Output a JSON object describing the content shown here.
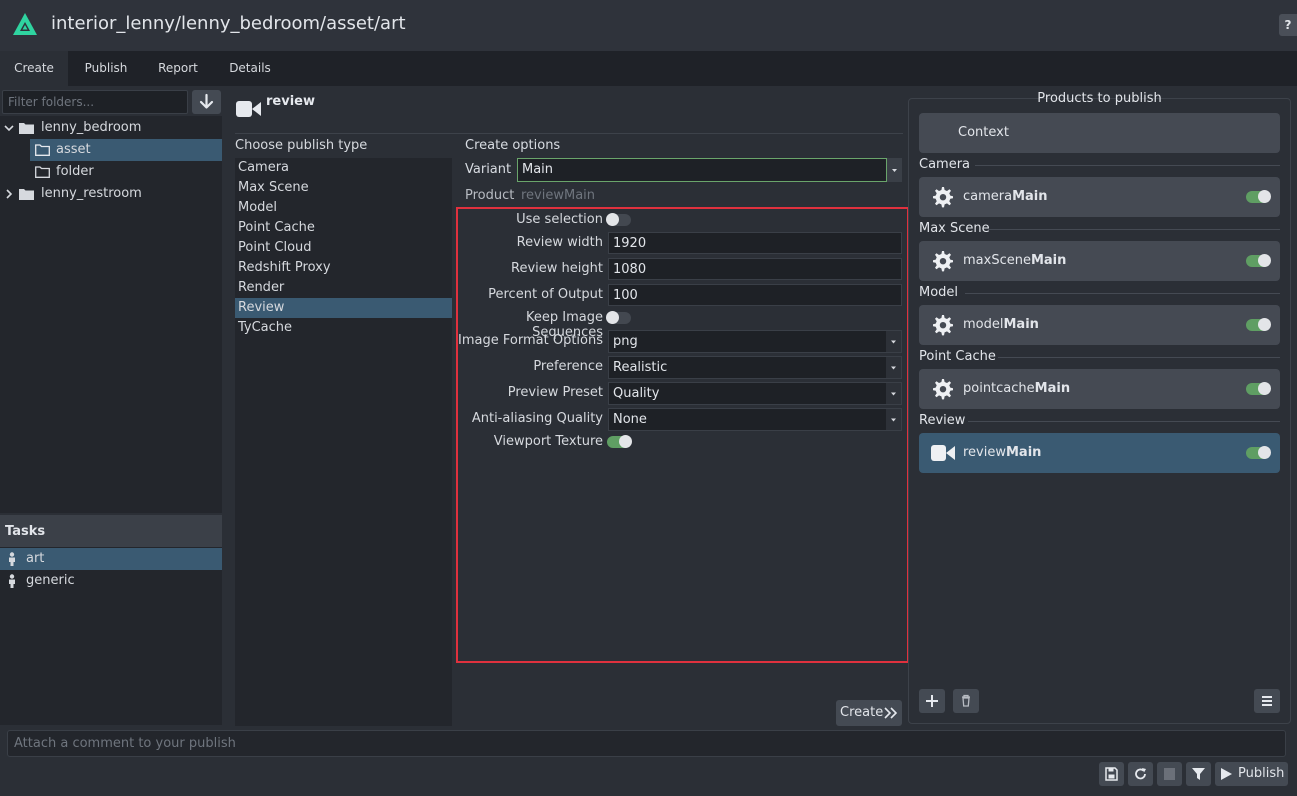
{
  "window": {
    "title": "interior_lenny/lenny_bedroom/asset/art",
    "help_label": "?"
  },
  "tabs": [
    "Create",
    "Publish",
    "Report",
    "Details"
  ],
  "folders": {
    "filter_placeholder": "Filter folders...",
    "items": [
      "lenny_bedroom",
      "asset",
      "folder",
      "lenny_restroom"
    ]
  },
  "tasks": {
    "header": "Tasks",
    "items": [
      "art",
      "generic"
    ]
  },
  "creator": {
    "name": "review",
    "choose_title": "Choose publish type",
    "types": [
      "Camera",
      "Max Scene",
      "Model",
      "Point Cache",
      "Point Cloud",
      "Redshift Proxy",
      "Render",
      "Review",
      "TyCache"
    ],
    "selected_type": "Review"
  },
  "options": {
    "title": "Create options",
    "variant_label": "Variant",
    "variant_value": "Main",
    "product_label": "Product",
    "product_value": "reviewMain",
    "use_selection_label": "Use selection",
    "use_selection": false,
    "review_width_label": "Review width",
    "review_width": "1920",
    "review_height_label": "Review height",
    "review_height": "1080",
    "percent_label": "Percent of Output",
    "percent": "100",
    "keep_seq_label": "Keep Image Sequences",
    "keep_seq": false,
    "image_format_label": "Image Format Options",
    "image_format": "png",
    "preference_label": "Preference",
    "preference": "Realistic",
    "preview_preset_label": "Preview Preset",
    "preview_preset": "Quality",
    "anti_alias_label": "Anti-aliasing Quality",
    "anti_alias": "None",
    "viewport_texture_label": "Viewport Texture",
    "viewport_texture": true,
    "create_label": "Create"
  },
  "products": {
    "title": "Products to publish",
    "context_label": "Context",
    "groups": [
      {
        "label": "Camera",
        "prefix": "camera",
        "suffix": "Main",
        "icon": "gear-icon"
      },
      {
        "label": "Max Scene",
        "prefix": "maxScene",
        "suffix": "Main",
        "icon": "gear-icon"
      },
      {
        "label": "Model",
        "prefix": "model",
        "suffix": "Main",
        "icon": "gear-icon"
      },
      {
        "label": "Point Cache",
        "prefix": "pointcache",
        "suffix": "Main",
        "icon": "gear-icon"
      },
      {
        "label": "Review",
        "prefix": "review",
        "suffix": "Main",
        "icon": "video-camera-icon"
      }
    ]
  },
  "bottom": {
    "comment_placeholder": "Attach a comment to your publish",
    "publish_label": "Publish"
  },
  "colors": {
    "accent": "#3a5a72",
    "toggle_on": "#5f9e63",
    "highlight_box": "#e0313e",
    "logo": "#2fd4a0"
  }
}
